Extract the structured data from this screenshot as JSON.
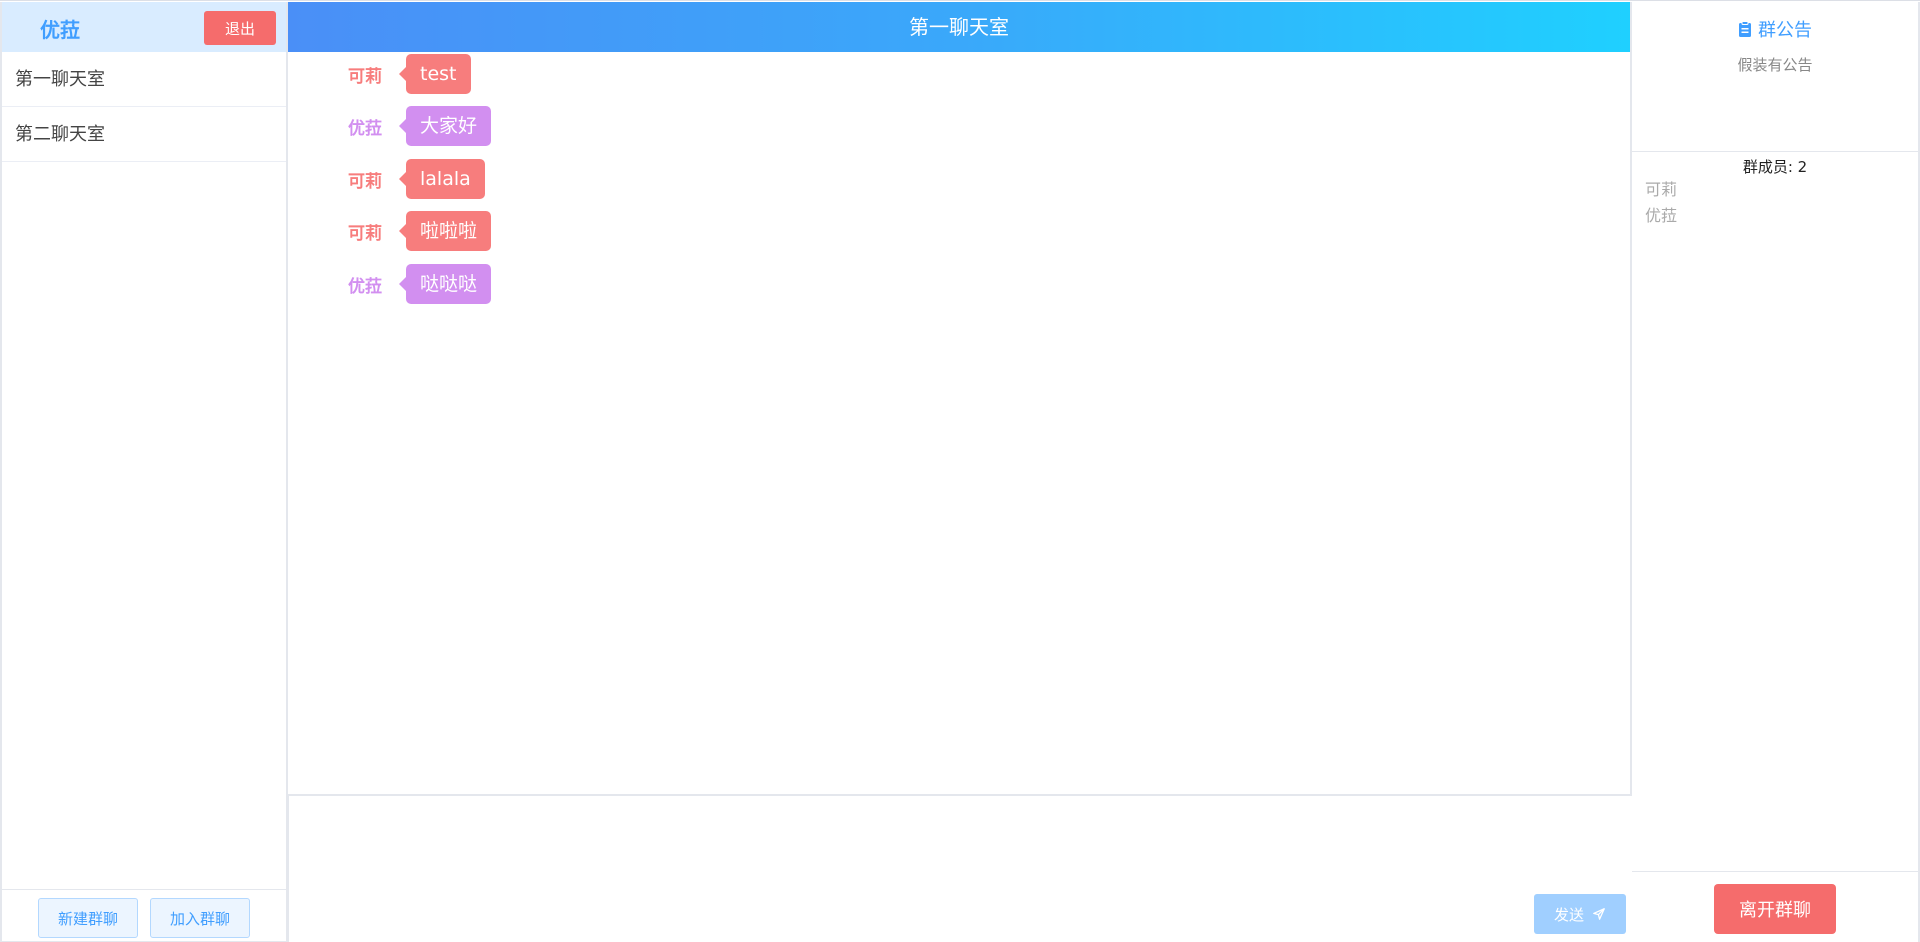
{
  "user": {
    "name": "优菈",
    "logout_label": "退出"
  },
  "sidebar": {
    "rooms": [
      {
        "label": "第一聊天室"
      },
      {
        "label": "第二聊天室"
      }
    ],
    "new_group_label": "新建群聊",
    "join_group_label": "加入群聊"
  },
  "chat": {
    "title": "第一聊天室",
    "messages": [
      {
        "sender": "可莉",
        "text": "test",
        "color": "#f77d7d"
      },
      {
        "sender": "优菈",
        "text": "大家好",
        "color": "#d28ff0"
      },
      {
        "sender": "可莉",
        "text": "lalala",
        "color": "#f77d7d"
      },
      {
        "sender": "可莉",
        "text": "啦啦啦",
        "color": "#f77d7d"
      },
      {
        "sender": "优菈",
        "text": "哒哒哒",
        "color": "#d28ff0"
      }
    ],
    "input_value": "",
    "send_label": "发送"
  },
  "panel": {
    "announcement_title": "群公告",
    "announcement_text": "假装有公告",
    "member_count_label": "群成员: 2",
    "members": [
      "可莉",
      "优菈"
    ],
    "leave_label": "离开群聊"
  },
  "colors": {
    "primary": "#409eff",
    "danger": "#f56c6c",
    "user_klee": "#f77d7d",
    "user_eula": "#d28ff0"
  }
}
